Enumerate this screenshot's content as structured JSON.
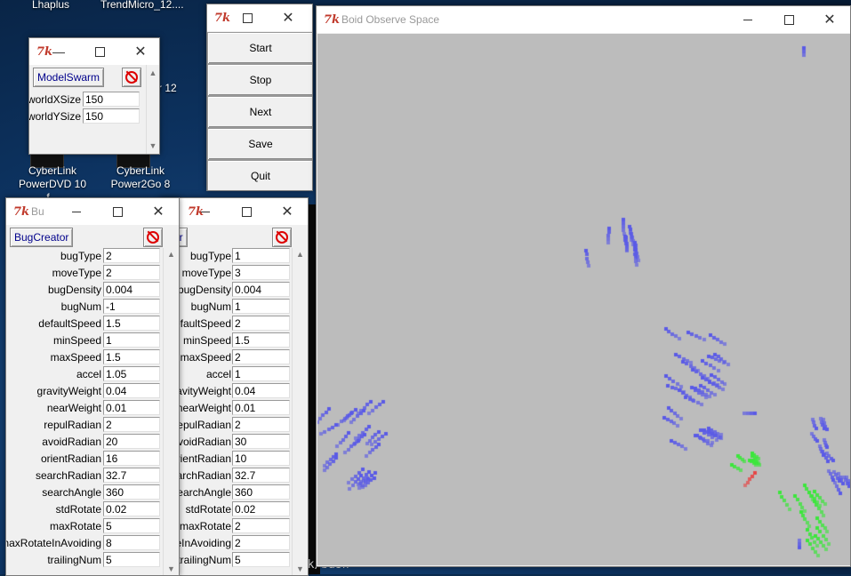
{
  "desktop": {
    "labels": [
      {
        "text": "Lhaplus"
      },
      {
        "text": "TrendMicro_12...."
      },
      {
        "text": "CyberLink"
      },
      {
        "text": "PowerDVD 10 f..."
      },
      {
        "text": "CyberLink"
      },
      {
        "text": "Power2Go 8"
      },
      {
        "text": "r 12"
      }
    ],
    "terminal_text": "ack/bash"
  },
  "model_swarm": {
    "title_icon": "7k",
    "title_dash": "—",
    "button": "ModelSwarm",
    "fields": [
      {
        "label": "worldXSize",
        "value": "150"
      },
      {
        "label": "worldYSize",
        "value": "150"
      }
    ]
  },
  "control_panel": {
    "title_icon": "7k",
    "buttons": [
      "Start",
      "Stop",
      "Next",
      "Save",
      "Quit"
    ]
  },
  "observe": {
    "title_icon": "7k",
    "title": "Boid Observe Space"
  },
  "bug1": {
    "title_icon": "7k",
    "title": "Bu",
    "button": "BugCreator",
    "fields": [
      {
        "label": "bugType",
        "value": "2"
      },
      {
        "label": "moveType",
        "value": "2"
      },
      {
        "label": "bugDensity",
        "value": "0.004"
      },
      {
        "label": "bugNum",
        "value": "-1"
      },
      {
        "label": "defaultSpeed",
        "value": "1.5"
      },
      {
        "label": "minSpeed",
        "value": "1"
      },
      {
        "label": "maxSpeed",
        "value": "1.5"
      },
      {
        "label": "accel",
        "value": "1.05"
      },
      {
        "label": "gravityWeight",
        "value": "0.04"
      },
      {
        "label": "nearWeight",
        "value": "0.01"
      },
      {
        "label": "repulRadian",
        "value": "2"
      },
      {
        "label": "avoidRadian",
        "value": "20"
      },
      {
        "label": "orientRadian",
        "value": "16"
      },
      {
        "label": "searchRadian",
        "value": "32.7"
      },
      {
        "label": "searchAngle",
        "value": "360"
      },
      {
        "label": "stdRotate",
        "value": "0.02"
      },
      {
        "label": "maxRotate",
        "value": "5"
      },
      {
        "label": "maxRotateInAvoiding",
        "value": "8"
      },
      {
        "label": "trailingNum",
        "value": "5"
      }
    ]
  },
  "bug2": {
    "title_icon": "7k",
    "button": "ator",
    "fields": [
      {
        "label": "bugType",
        "value": "1"
      },
      {
        "label": "moveType",
        "value": "3"
      },
      {
        "label": "bugDensity",
        "value": "0.004"
      },
      {
        "label": "bugNum",
        "value": "1"
      },
      {
        "label": "defaultSpeed",
        "value": "2"
      },
      {
        "label": "minSpeed",
        "value": "1.5"
      },
      {
        "label": "maxSpeed",
        "value": "2"
      },
      {
        "label": "accel",
        "value": "1"
      },
      {
        "label": "gravityWeight",
        "value": "0.04"
      },
      {
        "label": "nearWeight",
        "value": "0.01"
      },
      {
        "label": "repulRadian",
        "value": "2"
      },
      {
        "label": "avoidRadian",
        "value": "30"
      },
      {
        "label": "orientRadian",
        "value": "10"
      },
      {
        "label": "searchRadian",
        "value": "32.7"
      },
      {
        "label": "searchAngle",
        "value": "360"
      },
      {
        "label": "stdRotate",
        "value": "0.02"
      },
      {
        "label": "maxRotate",
        "value": "2"
      },
      {
        "label": "maxRotateInAvoiding",
        "value": "2"
      },
      {
        "label": "trailingNum",
        "value": "5"
      }
    ]
  },
  "colors": {
    "boid_blue": "#5a5ae6",
    "boid_green": "#3ce63c",
    "boid_red": "#e64646",
    "space_bg": "#bcbcbc"
  }
}
